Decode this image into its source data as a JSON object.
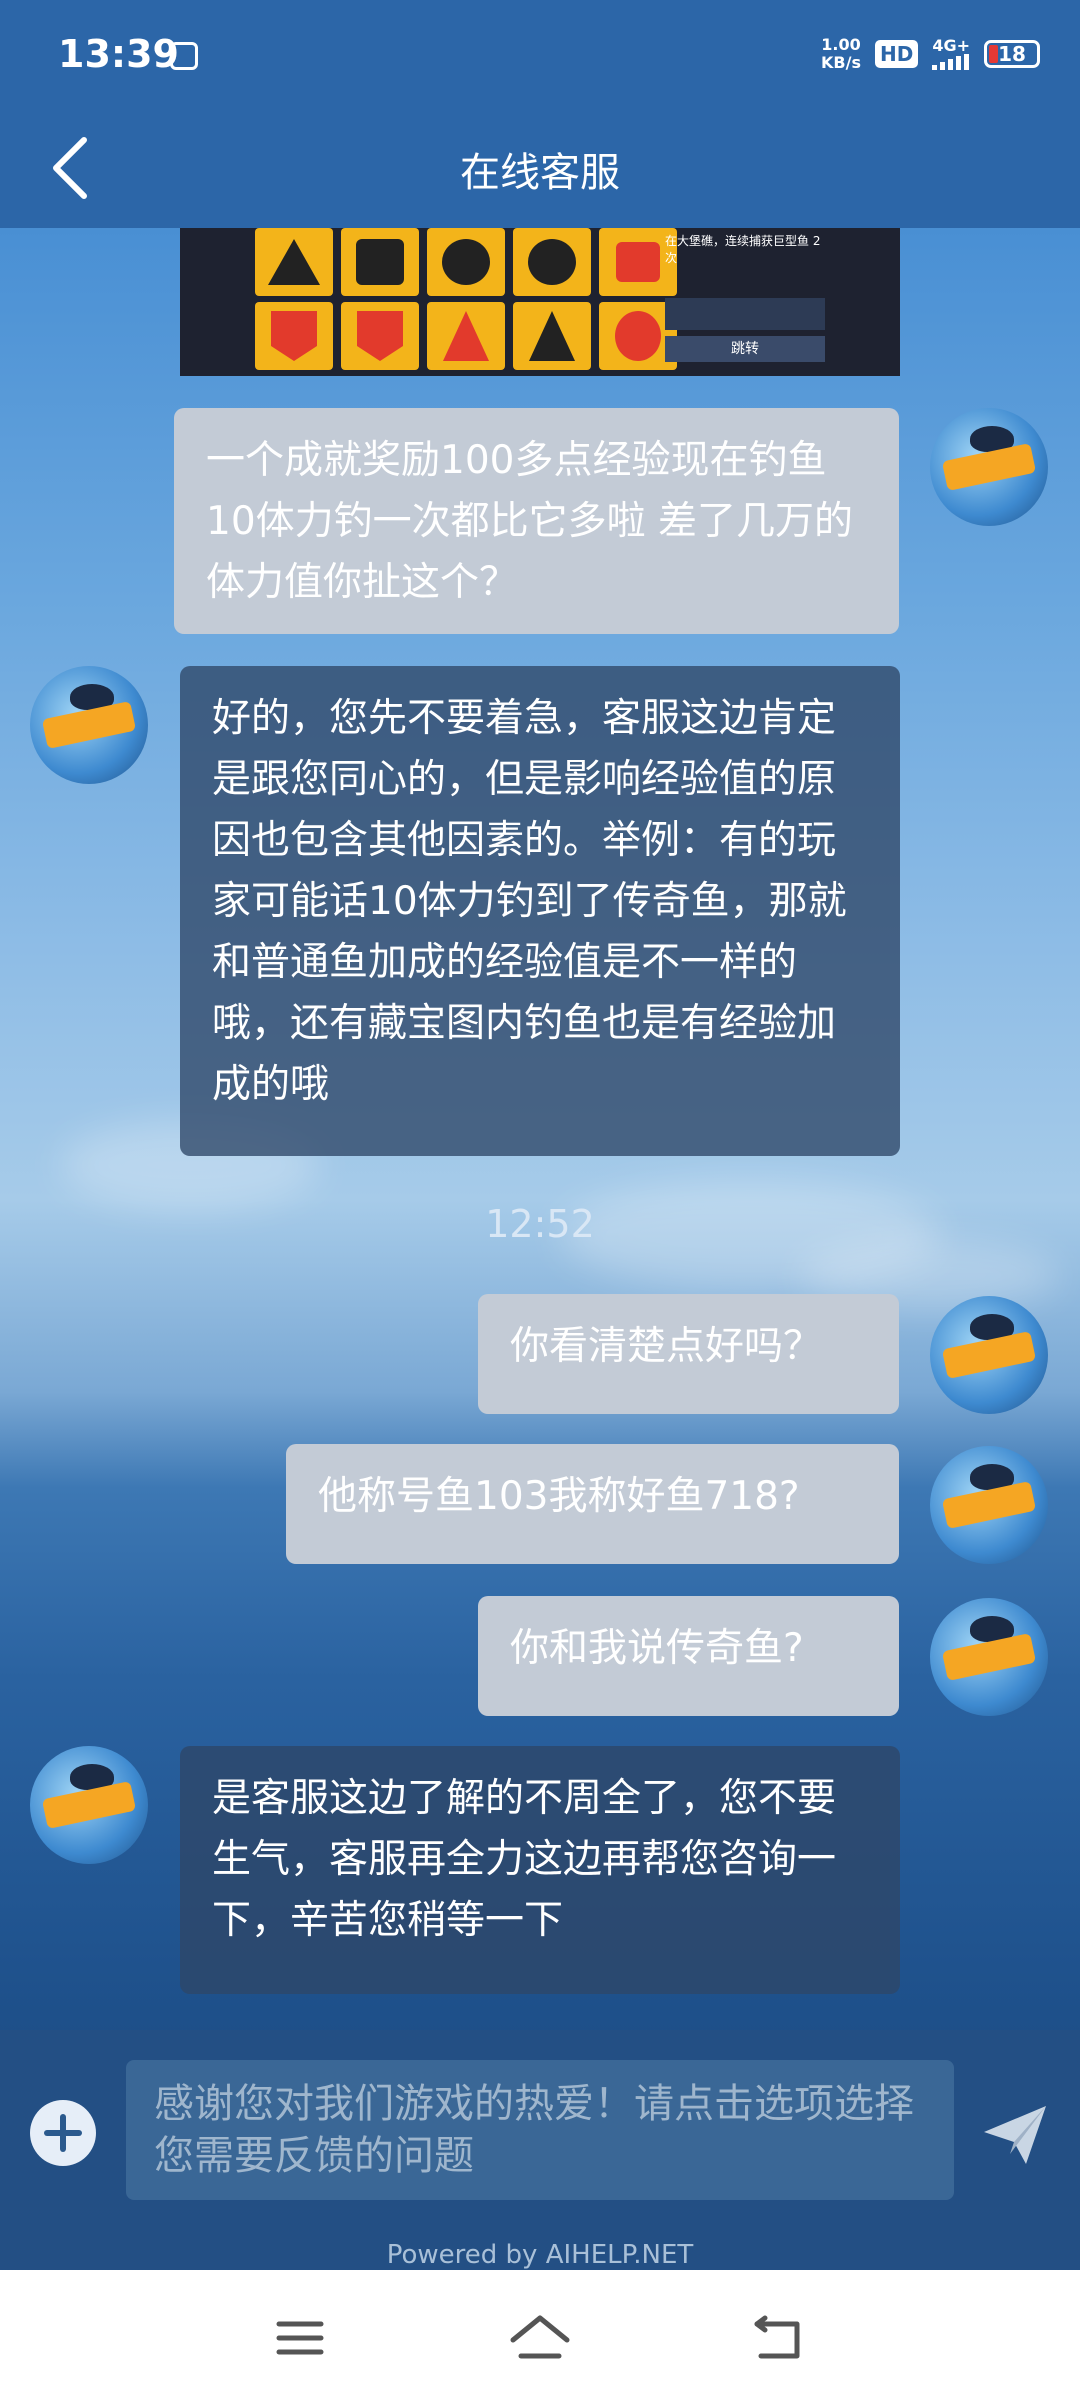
{
  "status_bar": {
    "time": "13:39",
    "net_speed_value": "1.00",
    "net_speed_unit": "KB/s",
    "hd": "HD",
    "network": "4G+",
    "battery": "18"
  },
  "header": {
    "title": "在线客服"
  },
  "screenshot_text": {
    "line1": "在大堡礁，连续捕获巨型鱼 2",
    "line2": "次",
    "jump": "跳转"
  },
  "messages": [
    {
      "from": "user",
      "text": "一个成就奖励100多点经验现在钓鱼10体力钓一次都比它多啦  差了几万的体力值你扯这个？"
    },
    {
      "from": "agent",
      "text": "好的，您先不要着急，客服这边肯定是跟您同心的，但是影响经验值的原因也包含其他因素的。举例：有的玩家可能话10体力钓到了传奇鱼，那就和普通鱼加成的经验值是不一样的哦，还有藏宝图内钓鱼也是有经验加成的哦"
    },
    {
      "from": "user",
      "text": "你看清楚点好吗？"
    },
    {
      "from": "user",
      "text": "他称号鱼103我称好鱼718?"
    },
    {
      "from": "user",
      "text": "你和我说传奇鱼?"
    },
    {
      "from": "agent",
      "text": "是客服这边了解的不周全了，您不要生气，客服再全力这边再帮您咨询一下，辛苦您稍等一下"
    }
  ],
  "timestamp": "12:52",
  "input": {
    "placeholder": "感谢您对我们游戏的热爱！请点击选项选择您需要反馈的问题"
  },
  "footer": {
    "powered_by": "Powered by AIHELP.NET"
  }
}
